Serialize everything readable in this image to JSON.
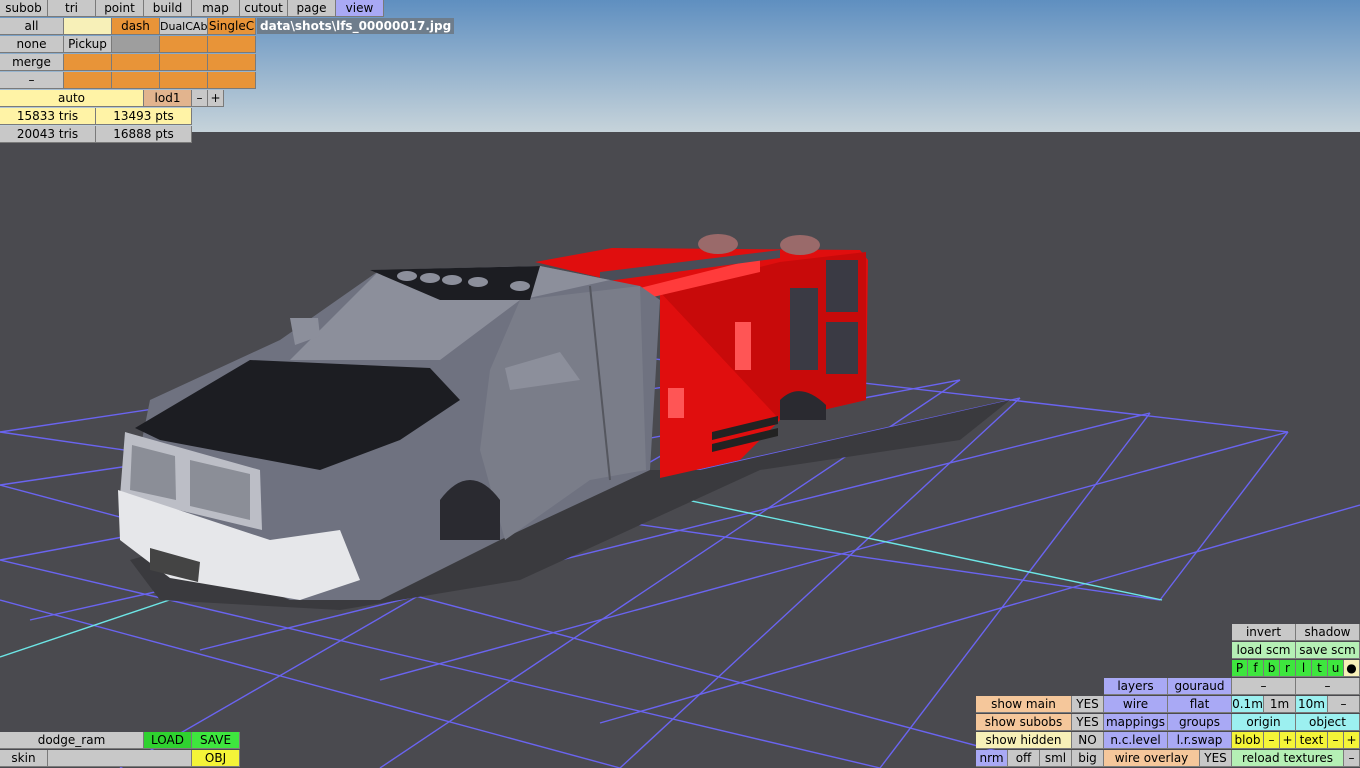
{
  "menu": [
    "subob",
    "tri",
    "point",
    "build",
    "map",
    "cutout",
    "page",
    "view"
  ],
  "file_path": "data\\shots\\lfs_00000017.jpg",
  "subob_panel": {
    "all": "all",
    "none": "none",
    "merge": "merge",
    "minus": "–",
    "dash": "dash",
    "dualcab": "DualCAb",
    "singlec": "SingleC",
    "pickup": "Pickup"
  },
  "lod": {
    "auto": "auto",
    "lod1": "lod1",
    "minus": "–",
    "plus": "+",
    "tris1": "15833 tris",
    "pts1": "13493 pts",
    "tris2": "20043 tris",
    "pts2": "16888 pts"
  },
  "bottom_left": {
    "name": "dodge_ram",
    "load": "LOAD",
    "save": "SAVE",
    "skin": "skin",
    "obj": "OBJ"
  },
  "view_panel": {
    "invert": "invert",
    "shadow": "shadow",
    "load_scm": "load scm",
    "save_scm": "save scm",
    "toggles": [
      "P",
      "f",
      "b",
      "r",
      "l",
      "t",
      "u",
      "●"
    ],
    "layers": "layers",
    "gouraud": "gouraud",
    "minus1": "–",
    "minus2": "–",
    "show_main": "show main",
    "show_main_val": "YES",
    "wire": "wire",
    "flat": "flat",
    "g01": "0.1m",
    "g1": "1m",
    "g10": "10m",
    "gminus": "–",
    "show_subobs": "show subobs",
    "show_subobs_val": "YES",
    "mappings": "mappings",
    "groups": "groups",
    "origin": "origin",
    "object": "object",
    "show_hidden": "show hidden",
    "show_hidden_val": "NO",
    "nc_level": "n.c.level",
    "lr_swap": "l.r.swap",
    "blob": "blob",
    "blob_minus": "–",
    "blob_plus": "+",
    "text": "text",
    "text_minus": "–",
    "text_plus": "+",
    "nrm": "nrm",
    "off": "off",
    "sml": "sml",
    "big": "big",
    "wire_overlay": "wire overlay",
    "wire_overlay_val": "YES",
    "reload_textures": "reload textures",
    "reload_minus": "–"
  },
  "colors": {
    "sky_top": "#5f8fc0",
    "sky_bottom": "#c6d3da",
    "ground": "#4a4a4f",
    "grid": "#6a64f0",
    "axis": "#6de6e6",
    "body_red": "#e00e0e",
    "truck_grey": "#6f7280",
    "hood_black": "#1c1d22"
  }
}
